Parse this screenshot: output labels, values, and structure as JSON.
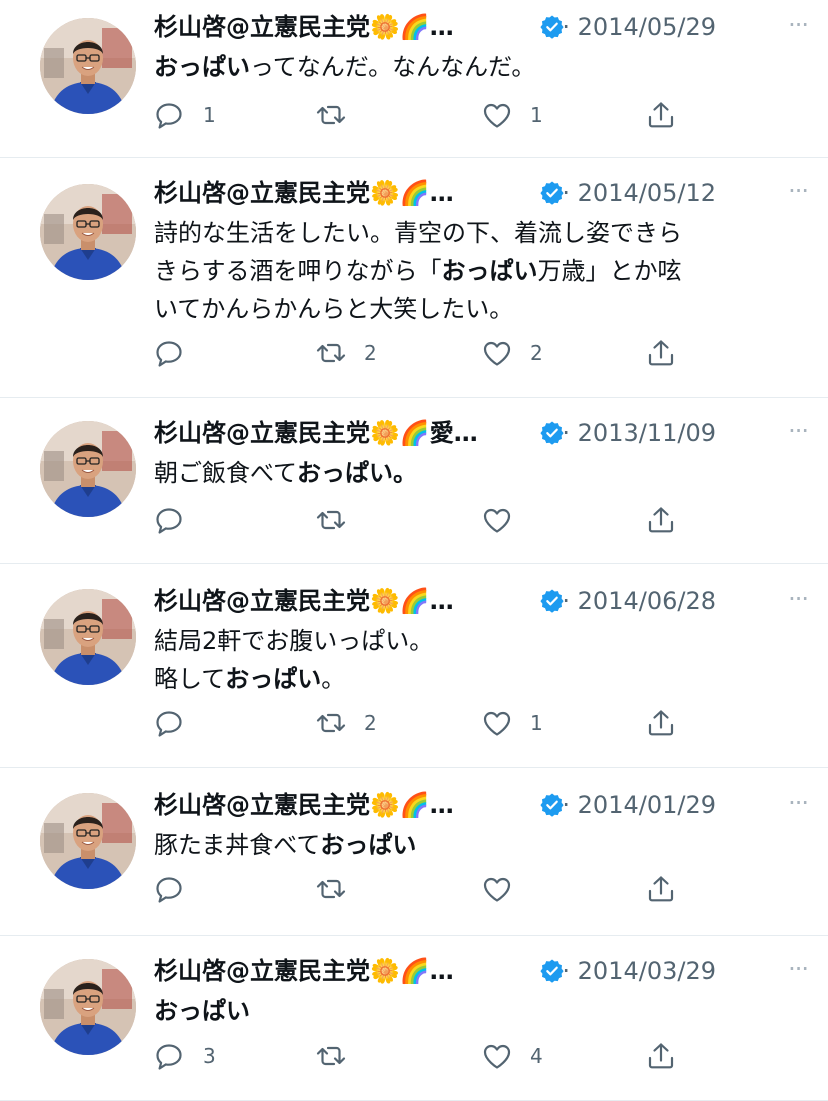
{
  "tweets": [
    {
      "name": "杉山啓@立憲民主党🌼🌈…",
      "date": "· 2014/05/29",
      "text_parts": [
        [
          "おっぱい",
          true
        ],
        [
          "ってなんだ。なんなんだ。",
          false
        ]
      ],
      "reply_count": "1",
      "retweet_count": "",
      "like_count": "1"
    },
    {
      "name": "杉山啓@立憲民主党🌼🌈…",
      "date": "· 2014/05/12",
      "text_parts": [
        [
          "詩的な生活をしたい。青空の下、着流し姿できら\nきらする酒を呷りながら「",
          false
        ],
        [
          "おっぱい",
          true
        ],
        [
          "万歳」とか呟\nいてかんらかんらと大笑したい。",
          false
        ]
      ],
      "reply_count": "",
      "retweet_count": "2",
      "like_count": "2"
    },
    {
      "name": "杉山啓@立憲民主党🌼🌈愛…",
      "date": "· 2013/11/09",
      "text_parts": [
        [
          "朝ご飯食べて",
          false
        ],
        [
          "おっぱい。",
          true
        ]
      ],
      "reply_count": "",
      "retweet_count": "",
      "like_count": ""
    },
    {
      "name": "杉山啓@立憲民主党🌼🌈…",
      "date": "· 2014/06/28",
      "text_parts": [
        [
          "結局2軒でお腹いっぱい。\n略して",
          false
        ],
        [
          "おっぱい",
          true
        ],
        [
          "。",
          false
        ]
      ],
      "reply_count": "",
      "retweet_count": "2",
      "like_count": "1"
    },
    {
      "name": "杉山啓@立憲民主党🌼🌈…",
      "date": "· 2014/01/29",
      "text_parts": [
        [
          "豚たま丼食べて",
          false
        ],
        [
          "おっぱい",
          true
        ]
      ],
      "reply_count": "",
      "retweet_count": "",
      "like_count": ""
    },
    {
      "name": "杉山啓@立憲民主党🌼🌈…",
      "date": "· 2014/03/29",
      "text_parts": [
        [
          "おっぱい",
          true
        ]
      ],
      "reply_count": "3",
      "retweet_count": "",
      "like_count": "4"
    }
  ],
  "more_label": "···",
  "icons": {
    "verified": "verified-badge-icon",
    "reply": "reply-icon",
    "retweet": "retweet-icon",
    "like": "heart-icon",
    "share": "share-icon"
  },
  "colors": {
    "verified": "#1d9bf0",
    "secondary_text": "#536471",
    "divider": "#e6ecf0"
  }
}
